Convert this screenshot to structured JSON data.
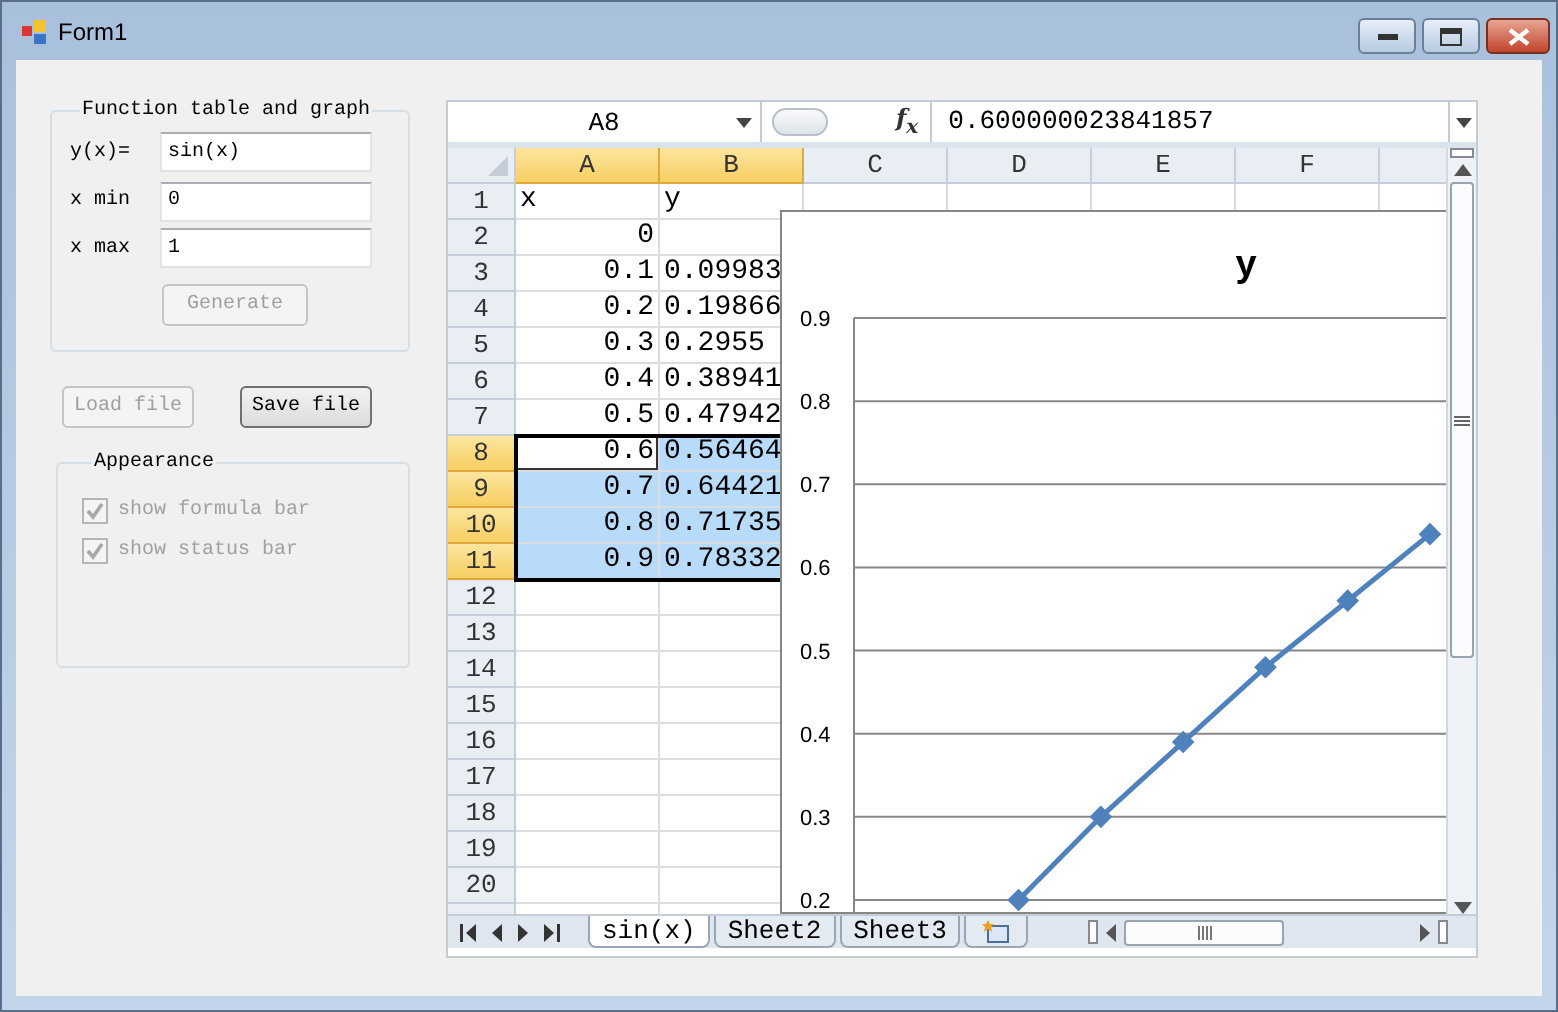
{
  "window": {
    "title": "Form1"
  },
  "function_group": {
    "title": "Function table and graph",
    "fields": [
      {
        "label": "y(x)=",
        "value": "sin(x)"
      },
      {
        "label": "x min",
        "value": "0"
      },
      {
        "label": "x max",
        "value": "1"
      }
    ],
    "generate_button": {
      "label": "Generate",
      "disabled": true
    }
  },
  "file_buttons": [
    {
      "label": "Load file",
      "disabled": true
    },
    {
      "label": "Save file",
      "disabled": false
    }
  ],
  "appearance_group": {
    "title": "Appearance",
    "options": [
      {
        "label": "show formula bar",
        "checked": true,
        "disabled": true
      },
      {
        "label": "show status bar",
        "checked": true,
        "disabled": true
      }
    ]
  },
  "spreadsheet": {
    "name_box": "A8",
    "function_label": "f$_{x}$",
    "formula": "0.600000023841857",
    "columns": [
      {
        "label": "A",
        "selected": true
      },
      {
        "label": "B",
        "selected": true
      },
      {
        "label": "C",
        "selected": false
      },
      {
        "label": "D",
        "selected": false
      },
      {
        "label": "E",
        "selected": false
      },
      {
        "label": "F",
        "selected": false
      }
    ],
    "rows": [
      {
        "label": "1",
        "selected": false,
        "cells": [
          {
            "text": "x",
            "kind": "label",
            "selected": false,
            "active": false
          },
          {
            "text": "y",
            "kind": "label",
            "selected": false,
            "active": false
          }
        ]
      },
      {
        "label": "2",
        "selected": false,
        "cells": [
          {
            "text": "0",
            "kind": "number",
            "selected": false,
            "active": false
          },
          {
            "kind": "label",
            "selected": false,
            "active": false
          }
        ]
      },
      {
        "label": "3",
        "selected": false,
        "cells": [
          {
            "text": "0.1",
            "kind": "number",
            "selected": false,
            "active": false
          },
          {
            "text": "0.09983",
            "kind": "label",
            "selected": false,
            "active": false
          }
        ]
      },
      {
        "label": "4",
        "selected": false,
        "cells": [
          {
            "text": "0.2",
            "kind": "number",
            "selected": false,
            "active": false
          },
          {
            "text": "0.19866",
            "kind": "label",
            "selected": false,
            "active": false
          }
        ]
      },
      {
        "label": "5",
        "selected": false,
        "cells": [
          {
            "text": "0.3",
            "kind": "number",
            "selected": false,
            "active": false
          },
          {
            "text": "0.2955",
            "kind": "label",
            "selected": false,
            "active": false
          }
        ]
      },
      {
        "label": "6",
        "selected": false,
        "cells": [
          {
            "text": "0.4",
            "kind": "number",
            "selected": false,
            "active": false
          },
          {
            "text": "0.38941",
            "kind": "label",
            "selected": false,
            "active": false
          }
        ]
      },
      {
        "label": "7",
        "selected": false,
        "cells": [
          {
            "text": "0.5",
            "kind": "number",
            "selected": false,
            "active": false
          },
          {
            "text": "0.47942",
            "kind": "label",
            "selected": false,
            "active": false
          }
        ]
      },
      {
        "label": "8",
        "selected": true,
        "cells": [
          {
            "text": "0.6",
            "kind": "number",
            "selected": true,
            "active": true
          },
          {
            "text": "0.56464",
            "kind": "label",
            "selected": true,
            "active": false
          }
        ]
      },
      {
        "label": "9",
        "selected": true,
        "cells": [
          {
            "text": "0.7",
            "kind": "number",
            "selected": true,
            "active": false
          },
          {
            "text": "0.64421",
            "kind": "label",
            "selected": true,
            "active": false
          }
        ]
      },
      {
        "label": "10",
        "selected": true,
        "cells": [
          {
            "text": "0.8",
            "kind": "number",
            "selected": true,
            "active": false
          },
          {
            "text": "0.71735",
            "kind": "label",
            "selected": true,
            "active": false
          }
        ]
      },
      {
        "label": "11",
        "selected": true,
        "cells": [
          {
            "text": "0.9",
            "kind": "number",
            "selected": true,
            "active": false
          },
          {
            "text": "0.78332",
            "kind": "label",
            "selected": true,
            "active": false
          }
        ]
      },
      {
        "label": "12",
        "selected": false,
        "cells": []
      },
      {
        "label": "13",
        "selected": false,
        "cells": []
      },
      {
        "label": "14",
        "selected": false,
        "cells": []
      },
      {
        "label": "15",
        "selected": false,
        "cells": []
      },
      {
        "label": "16",
        "selected": false,
        "cells": []
      },
      {
        "label": "17",
        "selected": false,
        "cells": []
      },
      {
        "label": "18",
        "selected": false,
        "cells": []
      },
      {
        "label": "19",
        "selected": false,
        "cells": []
      },
      {
        "label": "20",
        "selected": false,
        "cells": []
      }
    ],
    "chart": {
      "chart_data": {
        "type": "line",
        "title": "y",
        "ylim": [
          0.2,
          0.9
        ],
        "yticks": [
          0.2,
          0.3,
          0.4,
          0.5,
          0.6,
          0.7,
          0.8,
          0.9
        ],
        "grid": true,
        "series": [
          {
            "color": "#4f81bd",
            "marker": true,
            "values": [
              null,
              null,
              0.2,
              0.3,
              0.39,
              0.48,
              0.56,
              0.64
            ]
          }
        ]
      }
    },
    "sheet_tabs": [
      {
        "label": "sin(x)",
        "selected": true
      },
      {
        "label": "Sheet2",
        "selected": false
      },
      {
        "label": "Sheet3",
        "selected": false
      }
    ]
  }
}
